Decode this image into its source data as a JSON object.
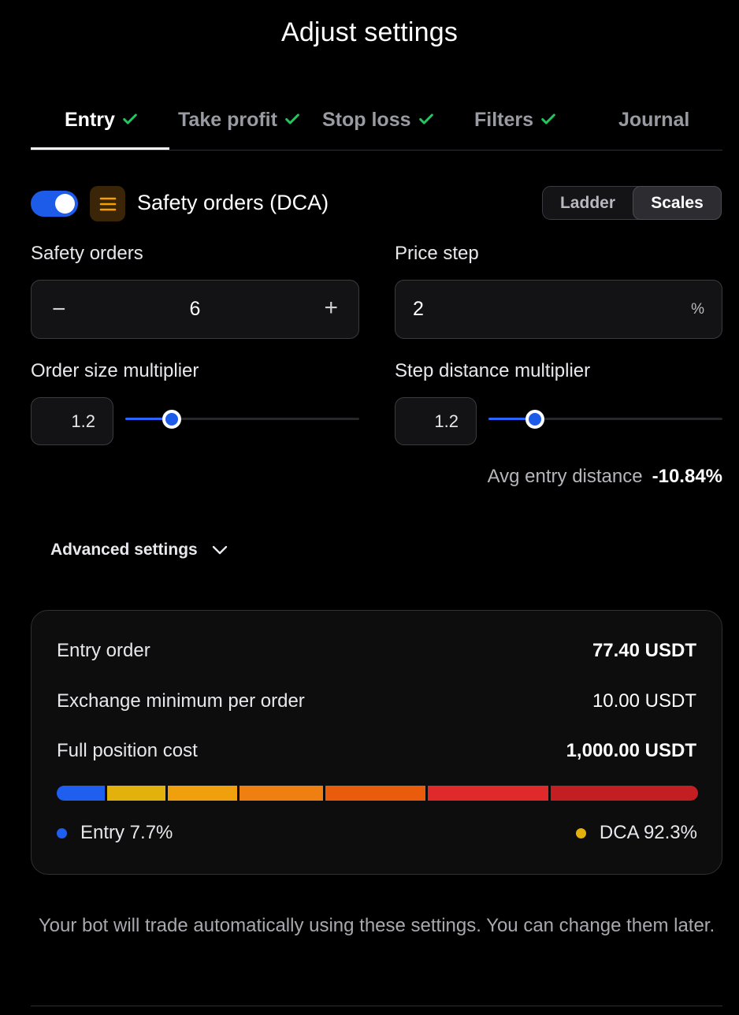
{
  "title": "Adjust settings",
  "tabs": [
    {
      "label": "Entry",
      "done": true,
      "active": true
    },
    {
      "label": "Take profit",
      "done": true
    },
    {
      "label": "Stop loss",
      "done": true
    },
    {
      "label": "Filters",
      "done": true
    },
    {
      "label": "Journal",
      "done": false
    }
  ],
  "dca": {
    "label": "Safety orders (DCA)",
    "enabled": true,
    "icon": "lines-icon",
    "modes": [
      "Ladder",
      "Scales"
    ],
    "selected_mode": "Scales"
  },
  "safety_orders": {
    "label": "Safety orders",
    "value": "6",
    "minus": "−",
    "plus": "+"
  },
  "price_step": {
    "label": "Price step",
    "value": "2",
    "unit": "%"
  },
  "order_size_multiplier": {
    "label": "Order size multiplier",
    "value": "1.2",
    "fraction": 0.2
  },
  "step_distance_multiplier": {
    "label": "Step distance multiplier",
    "value": "1.2",
    "fraction": 0.2
  },
  "avg_entry": {
    "label": "Avg entry distance",
    "value": "-10.84%"
  },
  "advanced": {
    "label": "Advanced settings"
  },
  "summary": {
    "entry_order": {
      "label": "Entry order",
      "value": "77.40 USDT"
    },
    "exchange_min": {
      "label": "Exchange minimum per order",
      "value": "10.00 USDT"
    },
    "full_cost": {
      "label": "Full position cost",
      "value": "1,000.00 USDT"
    },
    "bar_segments": [
      {
        "share": 7.7,
        "color": "#1f5ff0"
      },
      {
        "share": 9.2,
        "color": "#e3b10c"
      },
      {
        "share": 11.1,
        "color": "#f0a00c"
      },
      {
        "share": 13.3,
        "color": "#f07f12"
      },
      {
        "share": 16.0,
        "color": "#e85c0c"
      },
      {
        "share": 19.2,
        "color": "#e0292b"
      },
      {
        "share": 23.5,
        "color": "#c31f22"
      }
    ],
    "legend_entry": {
      "label": "Entry 7.7%",
      "color": "#1f5ff0"
    },
    "legend_dca": {
      "label": "DCA 92.3%",
      "color": "#e3b10c"
    }
  },
  "footnote": "Your bot will trade automatically using these settings. You can change them later."
}
